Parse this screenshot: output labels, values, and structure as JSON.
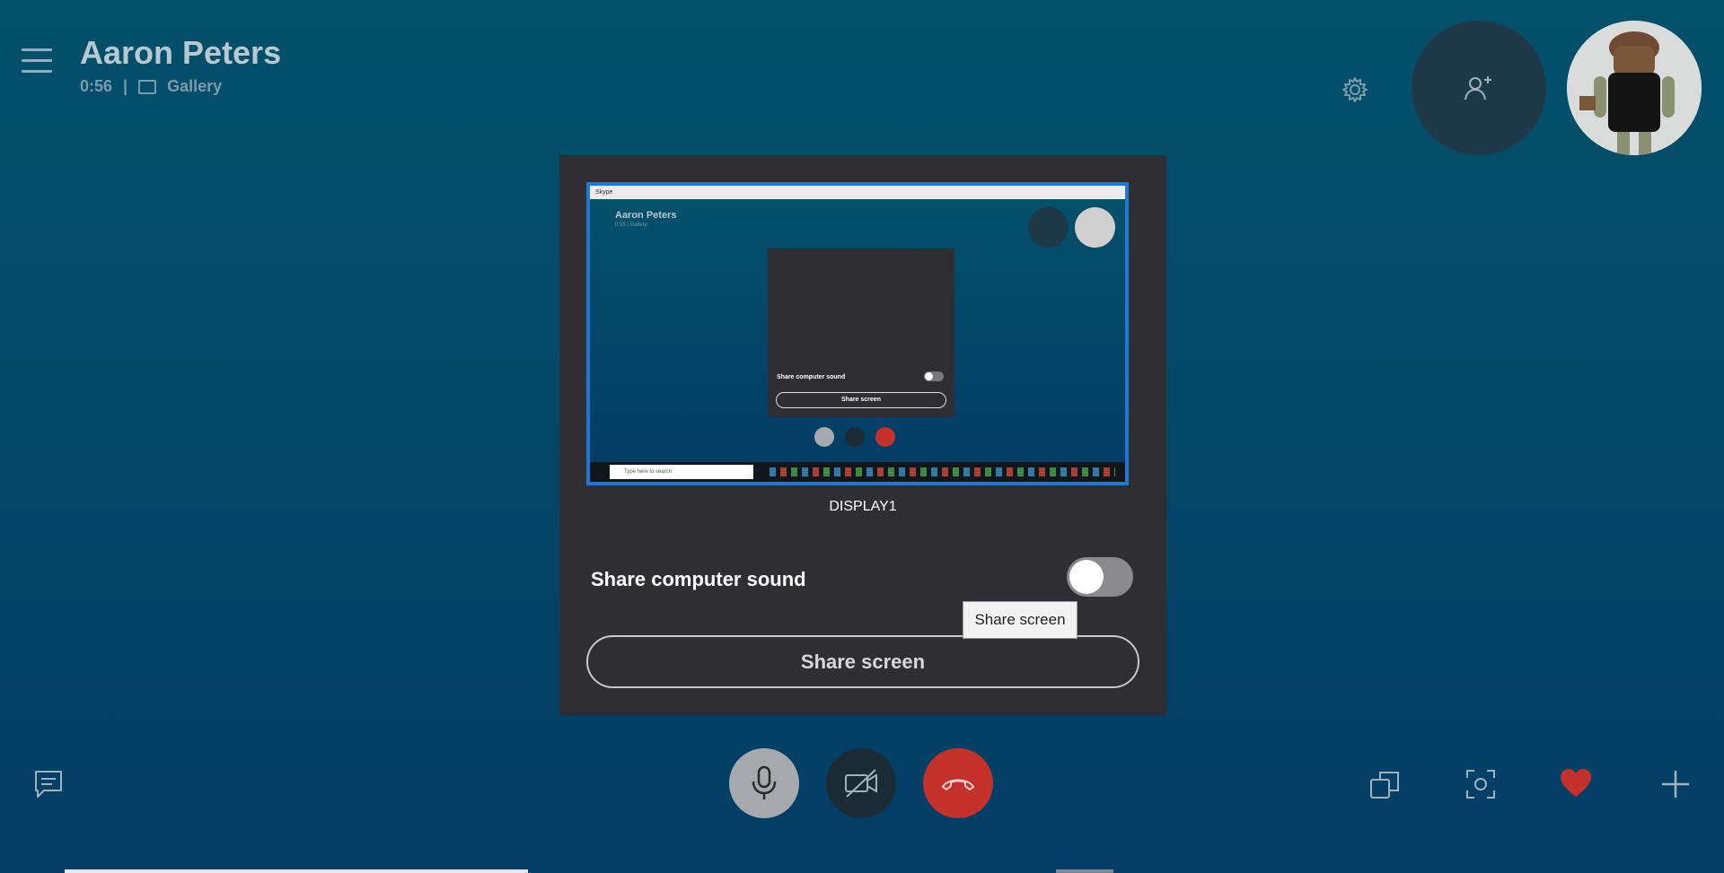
{
  "header": {
    "contact_name": "Aaron Peters",
    "call_duration": "0:56",
    "view_mode": "Gallery",
    "separator": "|"
  },
  "share_dialog": {
    "display_name": "DISPLAY1",
    "share_sound_label": "Share computer sound",
    "share_sound_enabled": false,
    "share_button_label": "Share screen",
    "tooltip": "Share screen"
  },
  "preview": {
    "window_title": "Skype",
    "contact_name": "Aaron Peters",
    "call_info": "0:55 | Gallery",
    "share_sound_label": "Share computer sound",
    "share_button_label": "Share screen",
    "search_placeholder": "Type here to search"
  },
  "controls": {
    "icons": [
      "menu-icon",
      "settings-icon",
      "add-person-icon",
      "chat-icon",
      "microphone-icon",
      "camera-off-icon",
      "hang-up-icon",
      "switch-view-icon",
      "snapshot-icon",
      "heart-icon",
      "plus-icon"
    ],
    "colors": {
      "accent": "#1e78d6",
      "hangup": "#c4312b",
      "heart": "#c4312b",
      "background": "#03506a"
    }
  }
}
